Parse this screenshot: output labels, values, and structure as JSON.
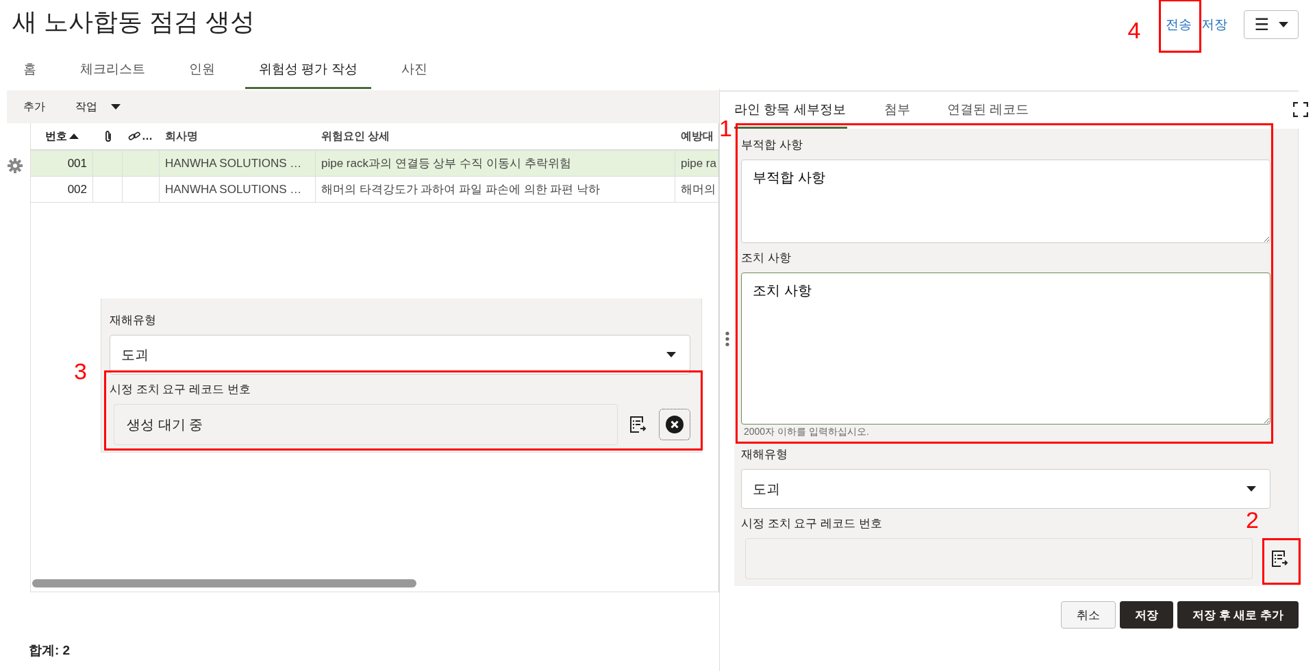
{
  "page_title": "새 노사합동 점검 생성",
  "header_actions": {
    "links": [
      {
        "label": "전송",
        "annotation": "4"
      },
      {
        "label": "저장"
      }
    ],
    "menu": {
      "icon": "☰"
    }
  },
  "tabs": [
    {
      "label": "홈",
      "selected": false
    },
    {
      "label": "체크리스트",
      "selected": false
    },
    {
      "label": "인원",
      "selected": false
    },
    {
      "label": "위험성 평가 작성",
      "selected": true
    },
    {
      "label": "사진",
      "selected": false
    }
  ],
  "toolbar": {
    "add": "추가",
    "actions": "작업"
  },
  "table": {
    "columns": [
      {
        "label": "번호",
        "kind": "sorted"
      },
      {
        "kind": "attachment"
      },
      {
        "label": "…",
        "kind": "link"
      },
      {
        "label": "회사명",
        "kind": "text"
      },
      {
        "label": "위험요인 상세",
        "kind": "text"
      },
      {
        "label": "예방대",
        "kind": "text"
      }
    ],
    "rows": [
      {
        "selected": true,
        "cells": [
          "001",
          "",
          "",
          "HANWHA SOLUTIONS …",
          "pipe rack과의 연결등 상부 수직 이동시 추락위험",
          "pipe ra"
        ]
      },
      {
        "selected": false,
        "cells": [
          "002",
          "",
          "",
          "HANWHA SOLUTIONS …",
          "해머의 타격강도가 과하여 파일 파손에 의한 파편 낙하",
          "해머의"
        ]
      }
    ]
  },
  "inline_form": {
    "type_label": "재해유형",
    "type_value": "도괴",
    "record_label": "시정 조치 요구 레코드 번호",
    "record_value": "생성 대기 중",
    "annotation": "3"
  },
  "total": "합계: 2",
  "detail_tabs": [
    {
      "label": "라인 항목 세부정보",
      "selected": true
    },
    {
      "label": "첨부",
      "selected": false
    },
    {
      "label": "연결된 레코드",
      "selected": false
    }
  ],
  "detail_form": {
    "annotation": "1",
    "textareas": [
      {
        "label": "부적합 사항",
        "value": "부적합 사항",
        "focused": false
      },
      {
        "label": "조치 사항",
        "value": "조치 사항",
        "focused": true
      }
    ],
    "hint": "2000자 이하를 입력하십시오.",
    "type_label": "재해유형",
    "type_value": "도괴",
    "record_label": "시정 조치 요구 레코드 번호",
    "record_button_annotation": "2"
  },
  "buttons": [
    {
      "label": "취소",
      "kind": "secondary"
    },
    {
      "label": "저장",
      "kind": "primary"
    },
    {
      "label": "저장 후 새로 추가",
      "kind": "primary"
    }
  ]
}
